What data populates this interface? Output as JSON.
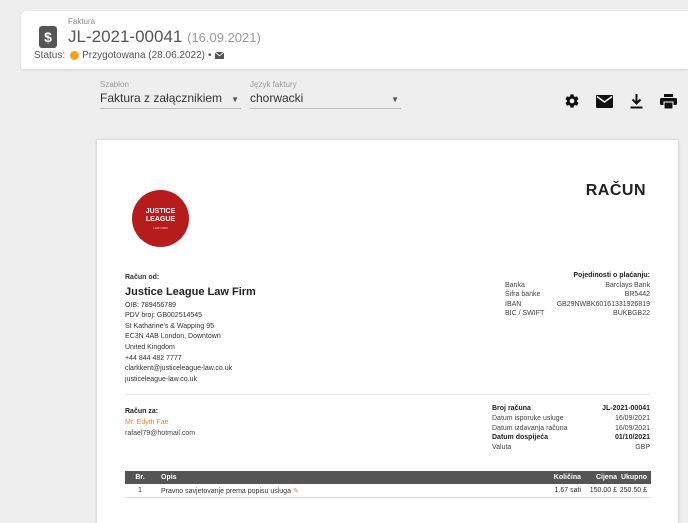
{
  "header": {
    "section_label": "Faktura",
    "invoice_number": "JL-2021-00041",
    "invoice_date": "(16.09.2021)",
    "status_label": "Status:",
    "status_text": "Przygotowana (28.06.2022)",
    "status_sep": "•",
    "status_color": "#f2a11b"
  },
  "controls": {
    "template": {
      "label": "Szablon",
      "value": "Faktura z załącznikiem"
    },
    "language": {
      "label": "Język faktury",
      "value": "chorwacki"
    }
  },
  "toolbar": [
    "settings-icon",
    "email-icon",
    "download-icon",
    "print-icon"
  ],
  "paper": {
    "title": "RAČUN",
    "logo": {
      "line1": "JUSTICE",
      "line2": "LEAGUE",
      "tagline": "LAW FIRM"
    },
    "from": {
      "caption": "Račun od:",
      "firm": "Justice League Law Firm",
      "lines": [
        "OIB: 789456789",
        "PDV broj: GB002514545",
        "St Katharine's & Wapping 95",
        "EC3N 4AB London, Downtown",
        "United Kingdom",
        "+44 844 482 7777",
        "clarkkent@justiceleague-law.co.uk",
        "justiceleague-law.co.uk"
      ]
    },
    "payment": {
      "caption": "Pojedinosti o plaćanju:",
      "rows": [
        {
          "k": "Banka",
          "v": "Barclays Bank"
        },
        {
          "k": "Šifra banke",
          "v": "BR5442"
        },
        {
          "k": "IBAN",
          "v": "GB29NWBK60161331926819"
        },
        {
          "k": "BIC / SWIFT",
          "v": "BUKBGB22"
        }
      ]
    },
    "to": {
      "caption": "Račun za:",
      "name": "Mr. Edyth Fae",
      "email": "rafael79@hotmail.com"
    },
    "meta": [
      {
        "k": "Broj računa",
        "v": "JL-2021-00041",
        "bold": true
      },
      {
        "k": "Datum isporuke usluge",
        "v": "16/09/2021",
        "bold": false
      },
      {
        "k": "Datum izdavanja računa",
        "v": "16/09/2021",
        "bold": false
      },
      {
        "k": "Datum dospijeća",
        "v": "01/10/2021",
        "bold": true
      },
      {
        "k": "Valuta",
        "v": "GBP",
        "bold": false
      }
    ],
    "items": {
      "headers": {
        "br": "Br.",
        "opis": "Opis",
        "kolicina": "Količina",
        "cijena": "Cijena",
        "ukupno": "Ukupno"
      },
      "rows": [
        {
          "br": "1",
          "opis": "Pravno savjetovanje prema popisu usluga",
          "kolicina": "1.67 sati",
          "cijena": "150.00 £",
          "ukupno": "250.50 £"
        }
      ]
    }
  }
}
